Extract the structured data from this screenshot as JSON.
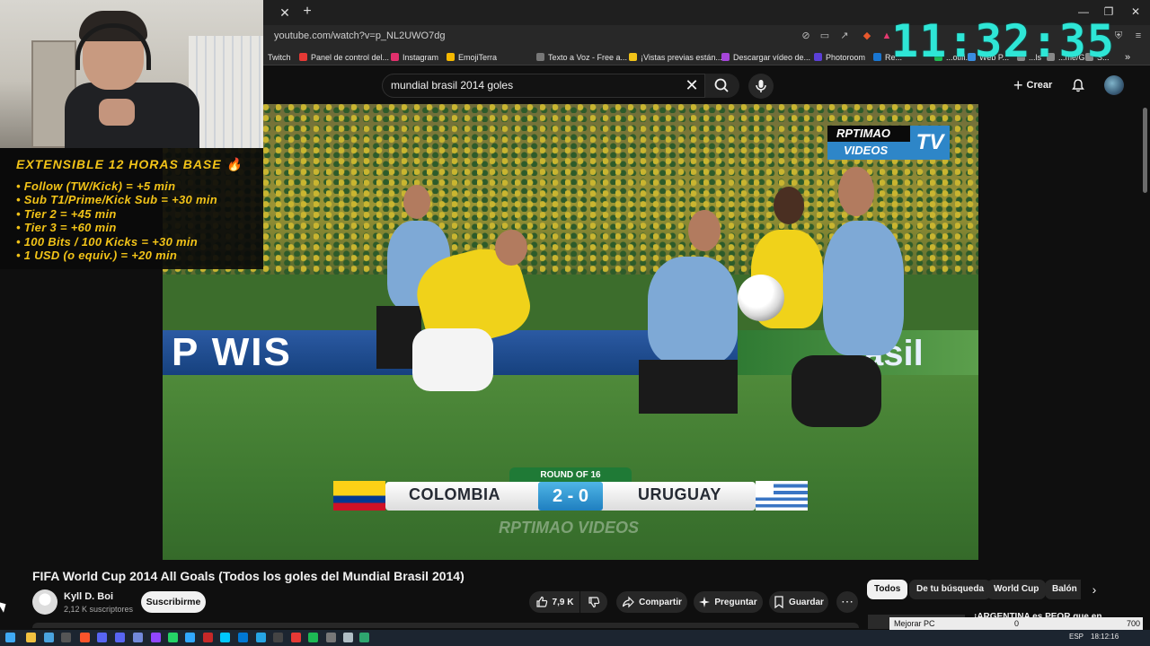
{
  "browser": {
    "tab_close": "✕",
    "tab_new": "+",
    "url": "youtube.com/watch?v=p_NL2UWO7dg",
    "window_controls": [
      "—",
      "❐",
      "✕"
    ],
    "bookmarks": [
      {
        "label": "Twitch",
        "color": "#9146ff"
      },
      {
        "label": "Panel de control del...",
        "color": "#e53935"
      },
      {
        "label": "Instagram",
        "color": "#e1306c"
      },
      {
        "label": "EmojiTerra",
        "color": "#f5b800"
      },
      {
        "label": "Texto a Voz - Free a...",
        "color": "#777777"
      },
      {
        "label": "¡Vistas previas están...",
        "color": "#f2c318"
      },
      {
        "label": "Descargar vídeo de...",
        "color": "#a646d9"
      },
      {
        "label": "Photoroom",
        "color": "#5b3fd6"
      },
      {
        "label": "Re...",
        "color": "#1976d2"
      },
      {
        "label": "...otifi...",
        "color": "#1db954"
      },
      {
        "label": "Web P...",
        "color": "#3a8de0"
      },
      {
        "label": "...ls",
        "color": "#888888"
      },
      {
        "label": "...me/G...",
        "color": "#888888"
      },
      {
        "label": "S...",
        "color": "#888888"
      }
    ],
    "bookmarks_more": "»"
  },
  "clock": "11:32:35",
  "stream_overlay": {
    "title": "EXTENSIBLE 12 HORAS BASE 🔥",
    "rules": [
      "• Follow (TW/Kick) = +5 min",
      "• Sub T1/Prime/Kick Sub = +30 min",
      "• Tier 2 = +45 min",
      "• Tier 3 = +60 min",
      "• 100 Bits / 100 Kicks = +30 min",
      "• 1 USD (o equiv.) = +20 min"
    ]
  },
  "youtube": {
    "search_value": "mundial brasil 2014 goles",
    "clear": "✕",
    "crear": "Crear",
    "crear_plus": "+"
  },
  "video": {
    "logo_top": "RPTIMAO",
    "logo_bottom": "VIDEOS",
    "logo_tv": "TV",
    "round": "ROUND OF 16",
    "team_left": "COLOMBIA",
    "team_right": "URUGUAY",
    "score": "2 - 0",
    "banner_left": "P WIS",
    "banner_right": "asil",
    "watermark": "RPTIMAO VIDEOS",
    "progress": 0.0
  },
  "meta": {
    "title": "FIFA World Cup 2014 All Goals (Todos los goles del Mundial Brasil 2014)",
    "channel": "Kyll D. Boi",
    "subscribers": "2,12 K suscriptores",
    "subscribe": "Suscribirme",
    "likes": "7,9 K",
    "share": "Compartir",
    "ask": "Preguntar",
    "save": "Guardar",
    "more": "⋯"
  },
  "chips": [
    "Todos",
    "De tu búsqueda",
    "World Cup",
    "Balón"
  ],
  "chips_next": "›",
  "recommendation_title": "¡ARGENTINA es PEOR que en...",
  "perf": {
    "label": "Mejorar PC",
    "value_mid": "0",
    "value_right": "700"
  },
  "taskbar": {
    "lang": "ESP",
    "time": "18:12:16"
  }
}
